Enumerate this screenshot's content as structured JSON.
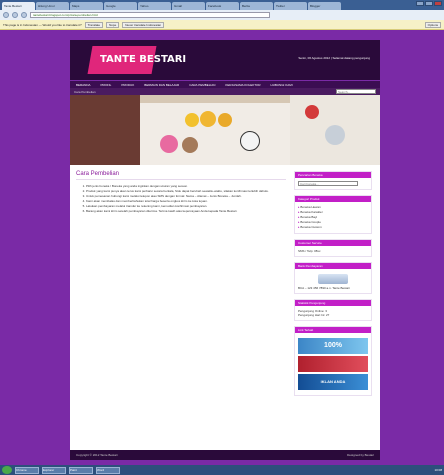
{
  "browser": {
    "tabs": [
      "Tante Bestari",
      "Hitung Umur",
      "Maps",
      "Google",
      "Yahoo",
      "Gmail",
      "Facebook",
      "Berita",
      "Twitter",
      "Blogger"
    ],
    "url": "tantebestari.blogspot.com/p/cara-pembelian.html",
    "translate_prompt": "This page is in Indonesian — Would you like to translate it?",
    "translate_button": "Translate",
    "nope_button": "Nope",
    "never_button": "Never translate Indonesian",
    "options_button": "Options"
  },
  "header": {
    "logo": "TANTE BESTARI",
    "date": "Senin, 06 Agustus 2012 | Selamat datang pengunjung"
  },
  "nav": [
    "BERANDA",
    "PROFIL",
    "PRODUK",
    "BERMAIN DAN BELAJAR",
    "CARA PEMBELIAN",
    "KERJASAMA KOLEKTOR",
    "HUBUNGI KAMI"
  ],
  "breadcrumb": "Cara Pembelian",
  "search_placeholder": "Search...",
  "main": {
    "title": "Cara Pembelian",
    "steps": [
      "Pilih jenis boneka / Boneka yang anda inginkan dengan ukuran yang sesuai.",
      "Produk yang kami punya akan terus kami perbarui secara berkala, Stok dapat berubah sewaktu-waktu, silakan konfirmasi terlebih dahulu.",
      "Untuk pemesanan hubungi kami melalui telepon atau SMS dengan format: Nama – Alamat – Jenis Boneka – Jumlah.",
      "Kami akan membalas dan memberitahukan total harga beserta ongkos kirim ke kota tujuan.",
      "Lakukan pembayaran melalui transfer ke rekening kami, kemudian konfirmasi pembayaran.",
      "Barang akan kami kirim setelah pembayaran diterima. Terima kasih atas kepercayaan Anda kepada Tante Bestari."
    ]
  },
  "sidebar": {
    "w1": {
      "title": "Pencarian Boneka",
      "field": "Cari boneka..."
    },
    "w2": {
      "title": "Kategori Produk",
      "items": [
        "Boneka Hewan",
        "Boneka Karakter",
        "Boneka Bayi",
        "Boneka Couple",
        "Boneka Custom"
      ]
    },
    "w3": {
      "title": "Customer Service",
      "body": "SMS / Telp: 08xx"
    },
    "w4": {
      "title": "Bank Pembayaran",
      "body": "BCA – 123 456 7890 a.n. Tante Bestari"
    },
    "w5": {
      "title": "Statistik Pengunjung",
      "line1": "Pengunjung Online: 3",
      "line2": "Pengunjung Hari Ini: 27"
    },
    "w6": {
      "title": "Link Terkait",
      "promo1": "100%",
      "promo2": "IKLAN ANDA"
    }
  },
  "footer": {
    "left": "Copyright © 2012 Tante Bestari",
    "right": "Designed by Bestari"
  },
  "taskbar": {
    "items": [
      "Chrome",
      "Explorer",
      "Paint",
      "Word"
    ],
    "clock": "10:08"
  }
}
